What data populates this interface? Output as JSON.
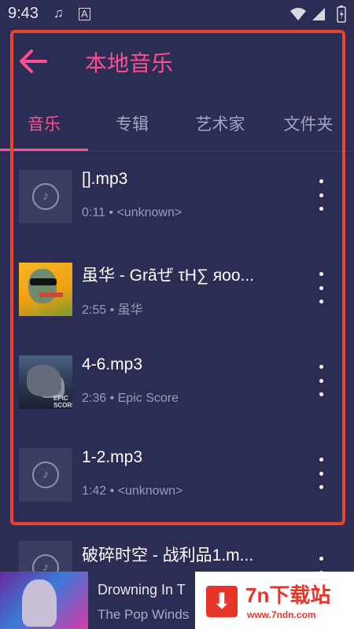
{
  "status_bar": {
    "time": "9:43",
    "icons": [
      "music-note-icon",
      "a-box-icon",
      "wifi-icon",
      "signal-icon",
      "battery-icon"
    ]
  },
  "toolbar": {
    "back_icon": "arrow-back-icon",
    "title": "本地音乐"
  },
  "tabs": [
    {
      "label": "音乐",
      "active": true
    },
    {
      "label": "专辑",
      "active": false
    },
    {
      "label": "艺术家",
      "active": false
    },
    {
      "label": "文件夹",
      "active": false
    }
  ],
  "songs": [
    {
      "title": "[].mp3",
      "meta": "0:11 • <unknown>",
      "cover": "default-disc-icon"
    },
    {
      "title": "虽华 - Grãぜ τH∑ яoo...",
      "meta": "2:55 • 虽华",
      "cover": "zombie-album-art"
    },
    {
      "title": "4-6.mp3",
      "meta": "2:36 • Epic Score",
      "cover": "epic-score-album-art",
      "cover_text": "EPIC SCORE"
    },
    {
      "title": "1-2.mp3",
      "meta": "1:42 • <unknown>",
      "cover": "default-disc-icon"
    },
    {
      "title": "破碎时空 - 战利品1.m...",
      "meta": "",
      "cover": "default-disc-icon"
    }
  ],
  "now_playing": {
    "title": "Drowning In T",
    "artist": "The Pop Winds"
  },
  "watermark": {
    "icon": "download-arrow-icon",
    "name": "7n下载站",
    "url": "www.7ndn.com"
  },
  "colors": {
    "background": "#2b2d55",
    "accent": "#ff4f8e",
    "highlight_box": "#e8452e",
    "secondary_text": "#9a9cb7"
  }
}
